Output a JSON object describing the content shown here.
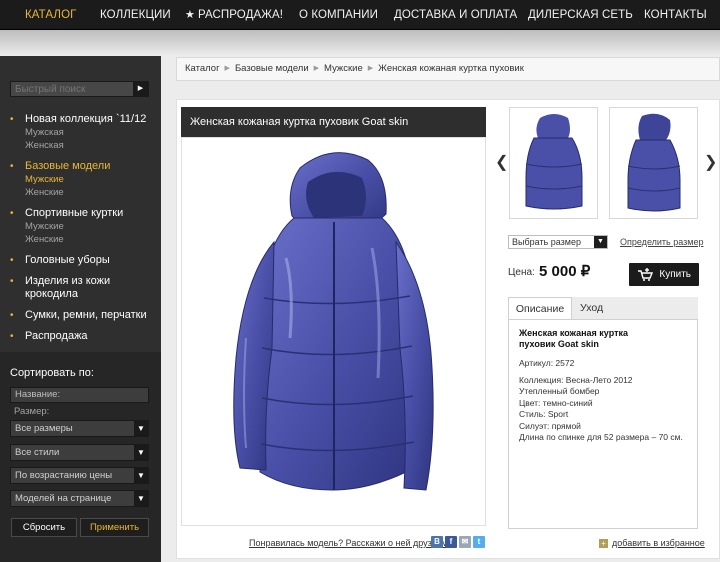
{
  "nav": {
    "items": [
      {
        "label": "КАТАЛОГ",
        "active": true
      },
      {
        "label": "КОЛЛЕКЦИИ"
      },
      {
        "label": "РАСПРОДАЖА!"
      },
      {
        "label": "О КОМПАНИИ"
      },
      {
        "label": "ДОСТАВКА И ОПЛАТА"
      },
      {
        "label": "ДИЛЕРСКАЯ СЕТЬ"
      },
      {
        "label": "КОНТАКТЫ"
      }
    ]
  },
  "sidebar": {
    "search_placeholder": "Быстрый поиск",
    "categories": [
      {
        "label": "Новая коллекция `11/12",
        "subs": [
          "Мужская",
          "Женская"
        ]
      },
      {
        "label": "Базовые модели",
        "active": true,
        "subs": [
          "Мужские",
          "Женские"
        ],
        "active_sub": 0
      },
      {
        "label": "Спортивные куртки",
        "subs": [
          "Мужские",
          "Женские"
        ]
      },
      {
        "label": "Головные уборы",
        "subs": []
      },
      {
        "label": "Изделия из кожи крокодила",
        "subs": []
      },
      {
        "label": "Сумки, ремни, перчатки",
        "subs": []
      },
      {
        "label": "Распродажа",
        "subs": []
      }
    ],
    "sort": {
      "title": "Сортировать по:",
      "name_placeholder": "Название:",
      "size_label": "Размер:",
      "dropdowns": [
        "Все размеры",
        "Все стили",
        "По возрастанию цены",
        "Моделей на странице"
      ],
      "reset": "Сбросить",
      "apply": "Применить"
    }
  },
  "breadcrumbs": [
    "Каталог",
    "Базовые модели",
    "Мужские",
    "Женская кожаная куртка пуховик"
  ],
  "product": {
    "title": "Женская кожаная куртка пуховик Goat skin",
    "size_select": "Выбрать размер",
    "size_link": "Определить размер",
    "price_label": "Цена:",
    "price": "5 000 ₽",
    "buy": "Купить",
    "tabs": [
      "Описание",
      "Уход"
    ],
    "description": {
      "heading": "Женская кожаная куртка пуховик Goat skin",
      "article": "Артикул: 2572",
      "lines": [
        "Коллекция: Весна-Лето 2012",
        "Утепленный бомбер",
        "Цвет: темно-синий",
        "Стиль: Sport",
        "Силуэт: прямой",
        "Длина по спинке для 52 размера – 70 см."
      ]
    },
    "share_text": "Понравилась модель? Расскажи о ней друзьям",
    "favorite": "добавить в избранное"
  },
  "colors": {
    "accent": "#e8b733",
    "jacket": "#4a50a8",
    "dark": "#1b1b1b"
  }
}
